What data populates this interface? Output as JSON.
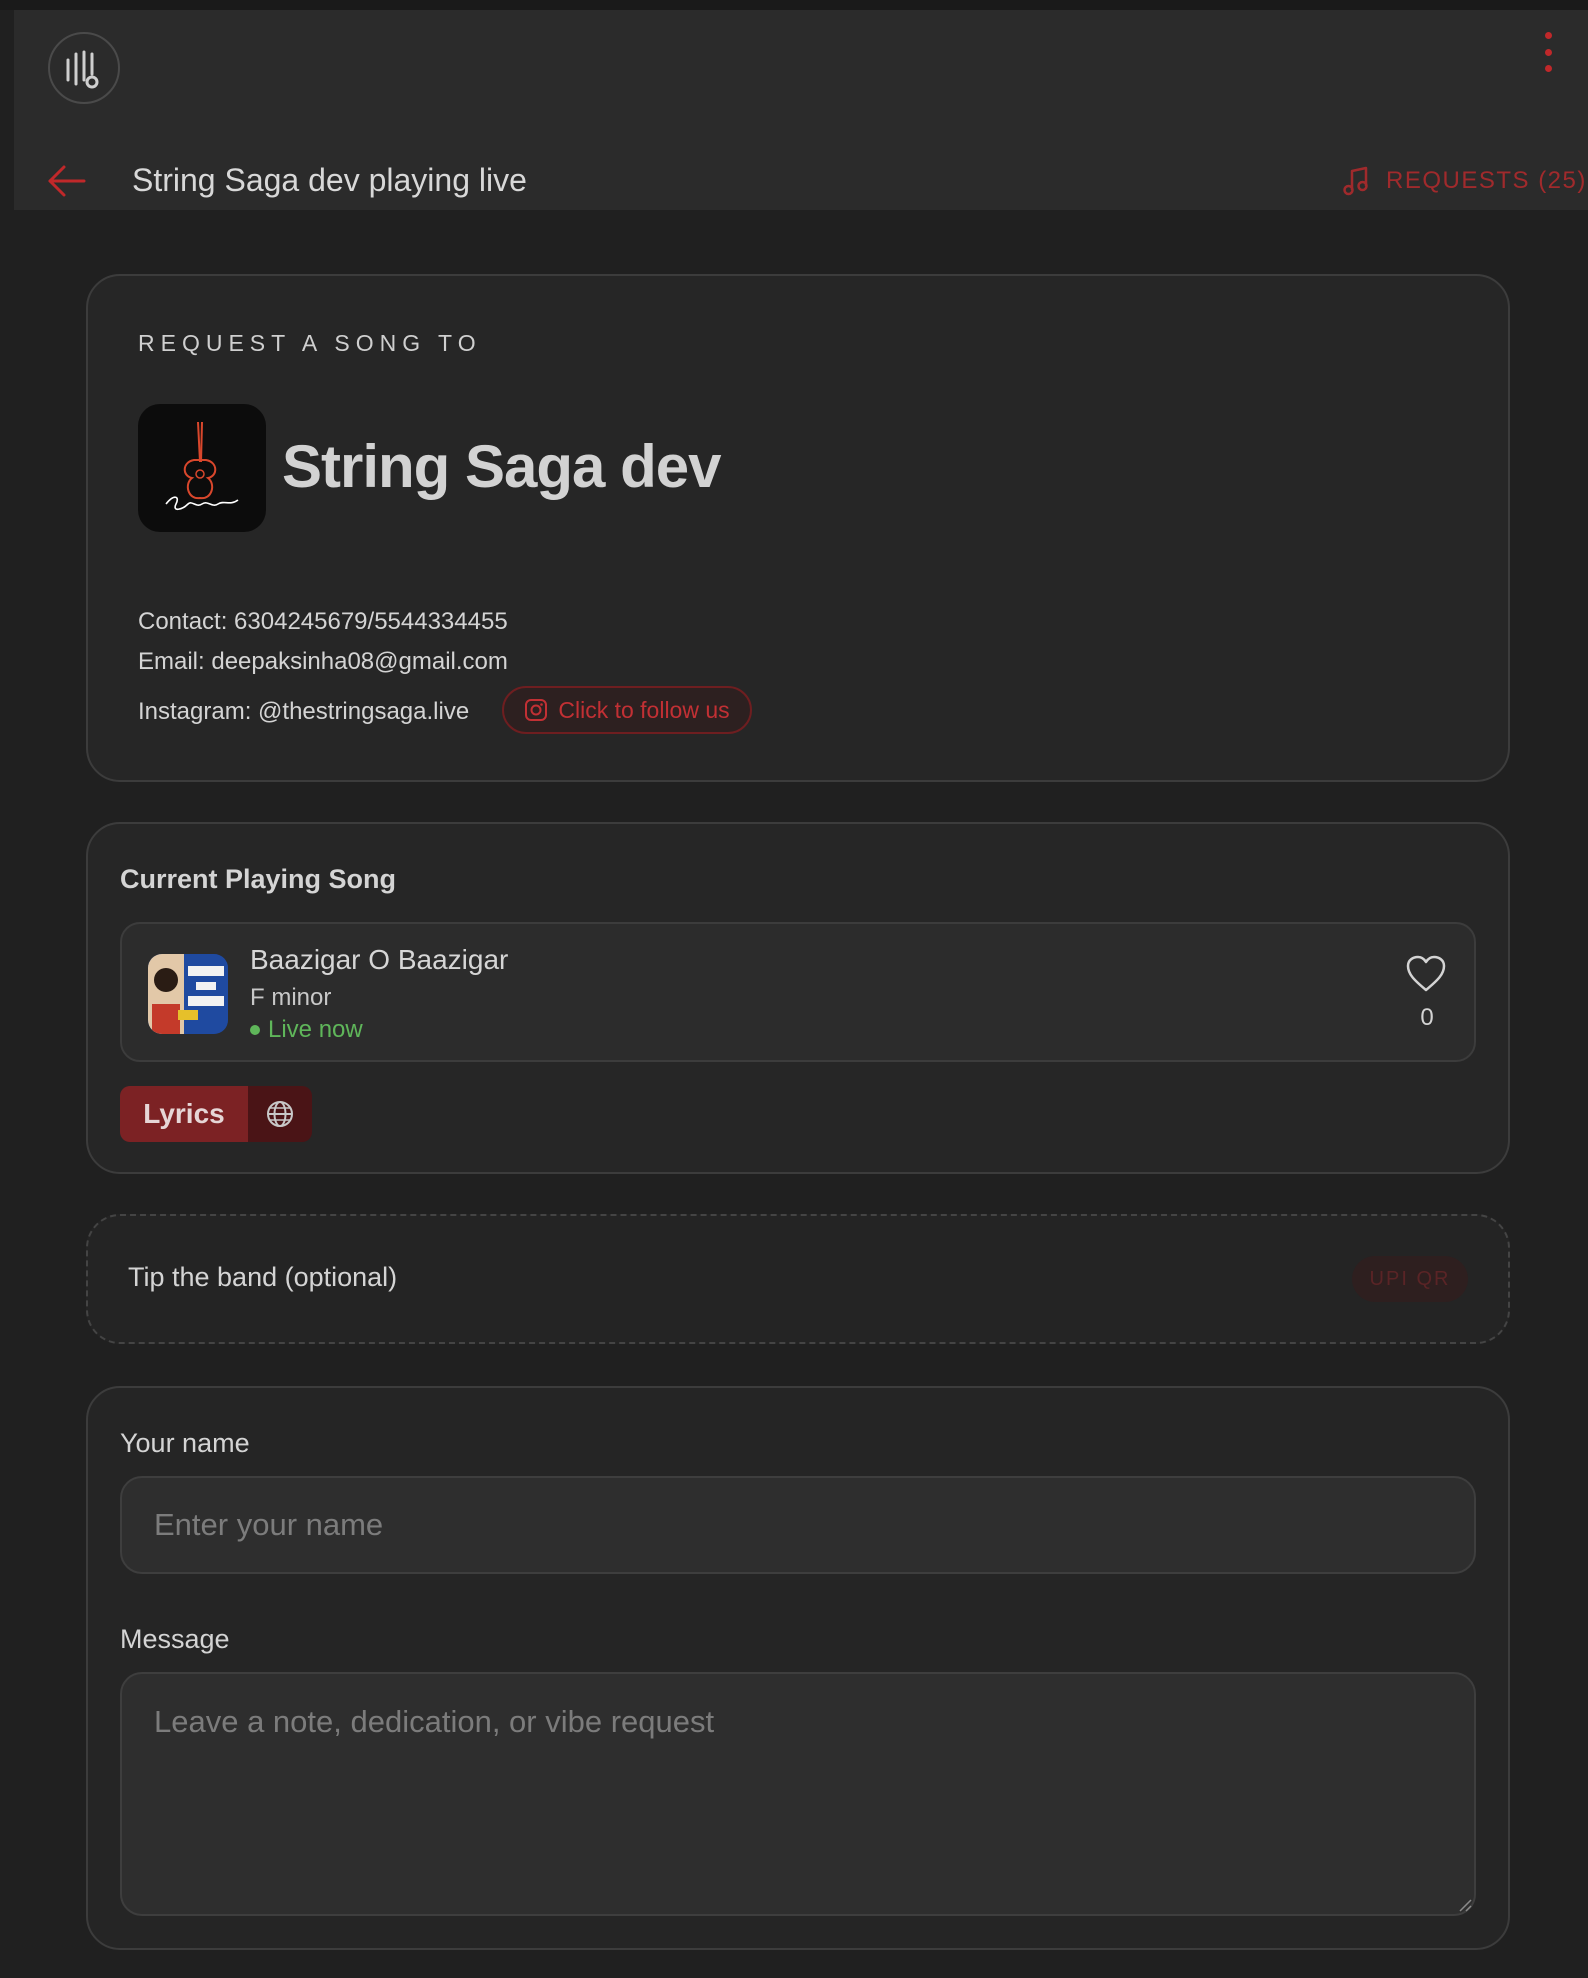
{
  "header": {
    "title": "String Saga dev playing live",
    "requests_label": "REQUESTS (25)"
  },
  "request_card": {
    "eyebrow": "REQUEST A SONG TO",
    "band_name": "String Saga dev",
    "contact": "Contact: 6304245679/5544334455",
    "email": "Email: deepaksinha08@gmail.com",
    "instagram": "Instagram: @thestringsaga.live",
    "follow_label": "Click to follow us"
  },
  "current_song": {
    "section_title": "Current Playing Song",
    "title": "Baazigar O Baazigar",
    "key": "F minor",
    "status": "Live now",
    "likes": "0",
    "lyrics_label": "Lyrics"
  },
  "tip": {
    "label": "Tip the band (optional)",
    "upi_label": "UPI QR"
  },
  "form": {
    "name_label": "Your name",
    "name_placeholder": "Enter your name",
    "message_label": "Message",
    "message_placeholder": "Leave a note, dedication, or vibe request"
  },
  "colors": {
    "accent": "#c0282a",
    "background": "#202020",
    "live": "#5fb65a"
  }
}
